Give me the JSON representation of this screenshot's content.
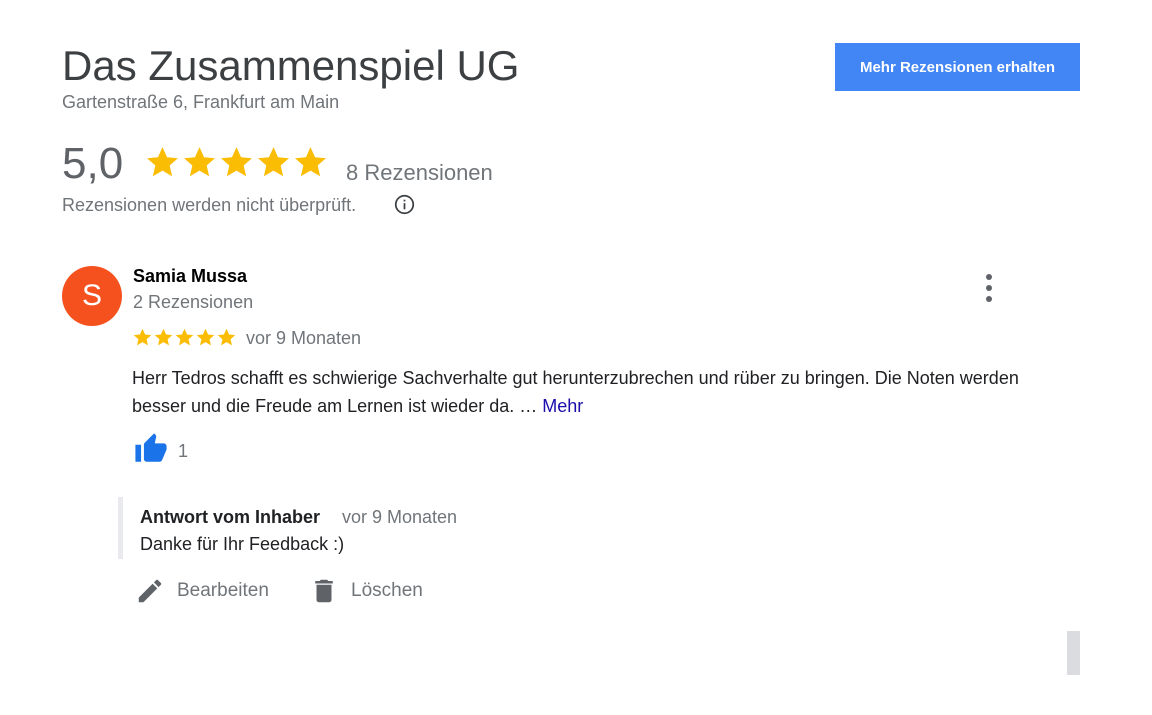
{
  "business": {
    "name": "Das Zusammenspiel UG",
    "address": "Gartenstraße 6, Frankfurt am Main"
  },
  "cta_label": "Mehr Rezensionen erhalten",
  "summary": {
    "rating": "5,0",
    "stars": 5,
    "review_count": "8 Rezensionen",
    "unverified_notice": "Rezensionen werden nicht überprüft."
  },
  "review": {
    "avatar_letter": "S",
    "author": "Samia Mussa",
    "author_reviews": "2 Rezensionen",
    "stars": 5,
    "time": "vor 9 Monaten",
    "text": "Herr Tedros schafft es schwierige Sachverhalte gut herunterzubrechen und rüber zu bringen. Die Noten werden besser und die Freude am Lernen ist wieder da. … ",
    "more_label": "Mehr",
    "likes": "1"
  },
  "owner_reply": {
    "label": "Antwort vom Inhaber",
    "time": "vor 9 Monaten",
    "text": "Danke für Ihr Feedback :)"
  },
  "actions": {
    "edit": "Bearbeiten",
    "delete": "Löschen"
  },
  "colors": {
    "star": "#fbbc04",
    "accent": "#4285f4",
    "avatar": "#f4511e",
    "thumb": "#1a73e8"
  },
  "icons": [
    "star-icon",
    "info-icon",
    "more-vert-icon",
    "thumb-up-icon",
    "edit-icon",
    "delete-icon"
  ]
}
